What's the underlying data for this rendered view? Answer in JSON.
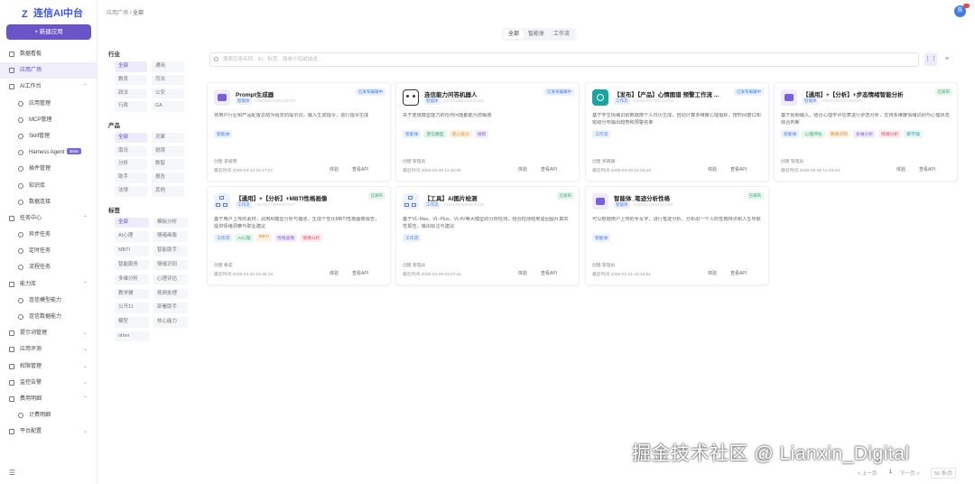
{
  "brand": {
    "name": "连信AI中台",
    "new_button": "+ 新建应用"
  },
  "sidebar": {
    "items": [
      {
        "label": "数据看板",
        "child": false,
        "caret": ""
      },
      {
        "label": "应用广场",
        "child": false,
        "active": true,
        "caret": ""
      },
      {
        "label": "AI工作台",
        "child": false,
        "caret": "^"
      },
      {
        "label": "应用管理",
        "child": true,
        "caret": ""
      },
      {
        "label": "MCP管理",
        "child": true,
        "caret": ""
      },
      {
        "label": "Skill管理",
        "child": true,
        "caret": ""
      },
      {
        "label": "Harness Agent",
        "child": true,
        "beta": "Beta",
        "caret": ""
      },
      {
        "label": "插件管理",
        "child": true,
        "caret": ""
      },
      {
        "label": "知识库",
        "child": true,
        "caret": ""
      },
      {
        "label": "数据连接",
        "child": true,
        "caret": ""
      },
      {
        "label": "任务中心",
        "child": false,
        "caret": "^"
      },
      {
        "label": "异步任务",
        "child": true,
        "caret": ""
      },
      {
        "label": "定时任务",
        "child": true,
        "caret": ""
      },
      {
        "label": "流程任务",
        "child": true,
        "caret": ""
      },
      {
        "label": "能力库",
        "child": false,
        "caret": "^"
      },
      {
        "label": "连信模型能力",
        "child": true,
        "caret": ""
      },
      {
        "label": "连信数据能力",
        "child": true,
        "caret": ""
      },
      {
        "label": "提示词管理",
        "child": false,
        "caret": "v"
      },
      {
        "label": "应用评测",
        "child": false,
        "caret": "v"
      },
      {
        "label": "权限管理",
        "child": false,
        "caret": "v"
      },
      {
        "label": "监控告警",
        "child": false,
        "caret": "v"
      },
      {
        "label": "费用明细",
        "child": false,
        "caret": "^"
      },
      {
        "label": "计费明细",
        "child": true,
        "caret": ""
      },
      {
        "label": "平台配置",
        "child": false,
        "caret": "v"
      }
    ]
  },
  "topbar": {
    "breadcrumb_parent": "应用广场",
    "breadcrumb_sep": "/",
    "breadcrumb_current": "全部",
    "avatar_text": "陈"
  },
  "segments": {
    "items": [
      "全部",
      "智能体",
      "工作流"
    ],
    "active": 0
  },
  "search": {
    "placeholder": "搜索应用名称、ID、标签、简单介绍或描述..."
  },
  "filters": {
    "industry": {
      "title": "行业",
      "options": [
        "全部",
        "通用",
        "教育",
        "司法",
        "政法",
        "公安",
        "行政",
        "GA"
      ],
      "active": 0
    },
    "product": {
      "title": "产品",
      "options": [
        "全部",
        "灵犀",
        "南讯",
        "锐境",
        "分析",
        "数智",
        "助手",
        "报告",
        "法律",
        "其他"
      ],
      "active": 0
    },
    "tag": {
      "title": "标签",
      "options": [
        "全部",
        "模板分析",
        "AI心理",
        "情绪画像",
        "MBTI",
        "智能助手",
        "智能服务",
        "情绪识别",
        "多维分析",
        "心理评估",
        "教学辅",
        "视频处理",
        "公开11",
        "部署助手",
        "模型",
        "核心能力",
        "other"
      ],
      "active": 0
    }
  },
  "colors": {
    "accent": "#6a55c8",
    "blue": "#3e7be8",
    "green_bg": "#e8f7ee",
    "green": "#35a66b",
    "blue_bg": "#e9f1ff"
  },
  "cards": [
    {
      "title": "Prompt生成器",
      "type": "智能体",
      "id": "134649287690139720",
      "status": "已发布编辑中",
      "status_kind": "blue",
      "desc": "将用户行业和产品配置总结为给定的提示词，输入生成指令，进行指令生成",
      "tags": [
        "智能体"
      ],
      "author": "创建 李俊明",
      "time": "最后时间 2026-03-13 15:17:27",
      "act1": "体验",
      "act2": "查看API",
      "icon": "purple"
    },
    {
      "title": "连信能力问答机器人",
      "type": "智能体",
      "id": "137442668400331060",
      "status": "已发布编辑中",
      "status_kind": "blue",
      "desc": "关于连信模型能力的任何问题都能为您解答",
      "tags": [
        "智能体",
        "连信模型",
        "连心能力",
        "搜智"
      ],
      "author": "创建 管理员",
      "time": "最后时间 2026-04-29 11:46:35",
      "act1": "体验",
      "act2": "查看API",
      "icon": "robot"
    },
    {
      "title": "【发布】【产品】心情图谱 预警工作流 ...",
      "type": "工作流",
      "id": "134437597751215700",
      "status": "已发布编辑中",
      "status_kind": "blue",
      "desc": "基于学生情绪识别数据按个人日历生成，自动计算多维度心理指标，按时间窗口和班级分布输出趋势和预警名单",
      "tags": [
        "工作流"
      ],
      "author": "创建 郑再镇",
      "time": "最后时间 2026-03-03 01:53:22",
      "act1": "体验",
      "act2": "查看API",
      "icon": "teal"
    },
    {
      "title": "【通用】+【分析】+步态情绪智能分析",
      "type": "智能体",
      "id": "135127627107093400",
      "status": "已发布",
      "status_kind": "green",
      "desc": "基于视频输入，结合心理学评估表进行步态分析，支持多维度情绪识别与心理状态综合判断",
      "tags": [
        "智能体",
        "心理评估",
        "情绪识别",
        "多维分析",
        "情绪分析",
        "教学辅"
      ],
      "author": "创建 管理员",
      "time": "最后时间 2026-05-06 12:26:03",
      "act1": "体验",
      "act2": "查看API",
      "icon": "purple"
    },
    {
      "title": "【通用】+【分析】+MBTI性格画像",
      "type": "工作流",
      "id": "135752479980037027",
      "status": "已发布",
      "status_kind": "green",
      "desc": "基于用户上传的素材，调用AI模型分析与描述，生成个性化MBTI性格画像报告，提供情绪洞察与职业建议",
      "tags": [
        "工作流",
        "AI心理",
        "MBTI",
        "性格画像",
        "情绪分析"
      ],
      "author": "创建 秦成",
      "time": "最后时间 2026-04-20 16:38:13",
      "act1": "体验",
      "act2": "查看API",
      "icon": "flow"
    },
    {
      "title": "【工具】AI图片检测",
      "type": "工作流",
      "id": "134434561053032335",
      "status": "已发布",
      "status_kind": "green",
      "desc": "基于VL-Max、VL-Plus、VL4V等大模型的分析检测，结合检测结果返回图片真实性报告，输出标注与建议",
      "tags": [
        "工作流"
      ],
      "author": "创建 管理员",
      "time": "最后时间 2026-04-20 03:37:41",
      "act1": "体验",
      "act2": "查看API",
      "icon": "flow"
    },
    {
      "title": "智能体_笔迹分析性格",
      "type": "智能体",
      "id": "132059113001827850",
      "status": "已发布",
      "status_kind": "green",
      "desc": "可以根据用户上传的手写字，进行笔迹分析，分析出一个人的性格特点和人生导航",
      "tags": [
        "智能体"
      ],
      "author": "创建 管理员",
      "time": "最后时间 2026-01-21 22:42:51",
      "act1": "体验",
      "act2": "查看API",
      "icon": "purple"
    }
  ],
  "pager": {
    "prev": "< 上一页",
    "page": "1",
    "next": "下一页 >",
    "size": "50 条/页"
  },
  "watermark": "掘金技术社区 @ Lianxin_Digital"
}
